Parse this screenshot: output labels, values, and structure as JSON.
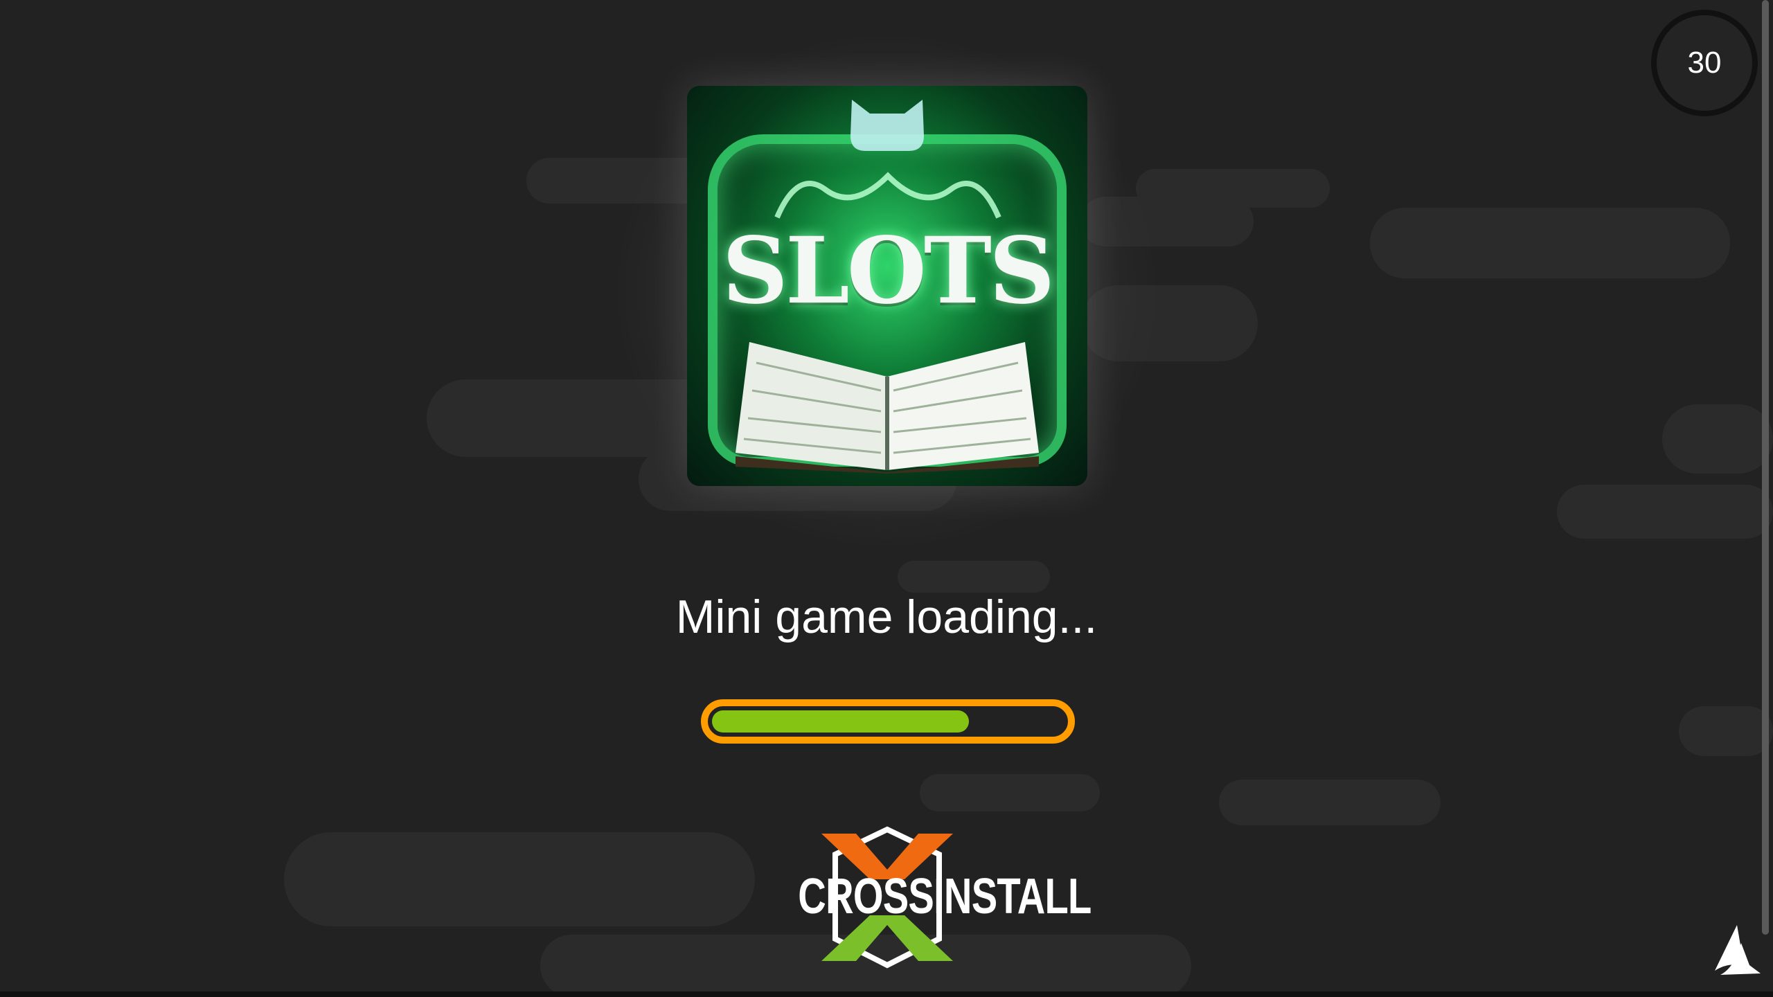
{
  "countdown": {
    "seconds": "30"
  },
  "app_icon": {
    "title_text": "SLOTS"
  },
  "loading": {
    "message": "Mini game loading...",
    "progress_percent": 73
  },
  "brand": {
    "name": "CROSSINSTALL"
  },
  "colors": {
    "background": "#222222",
    "progress_border": "#ff9c00",
    "progress_fill": "#86c414",
    "brand_orange": "#f06a12",
    "brand_green": "#7bbf2a",
    "icon_green": "#2fd46a"
  },
  "icons": {
    "corner_logo": "sail-logo-icon",
    "app_icon": "slots-book-app-icon",
    "brand_logo": "crossinstall-logo"
  }
}
